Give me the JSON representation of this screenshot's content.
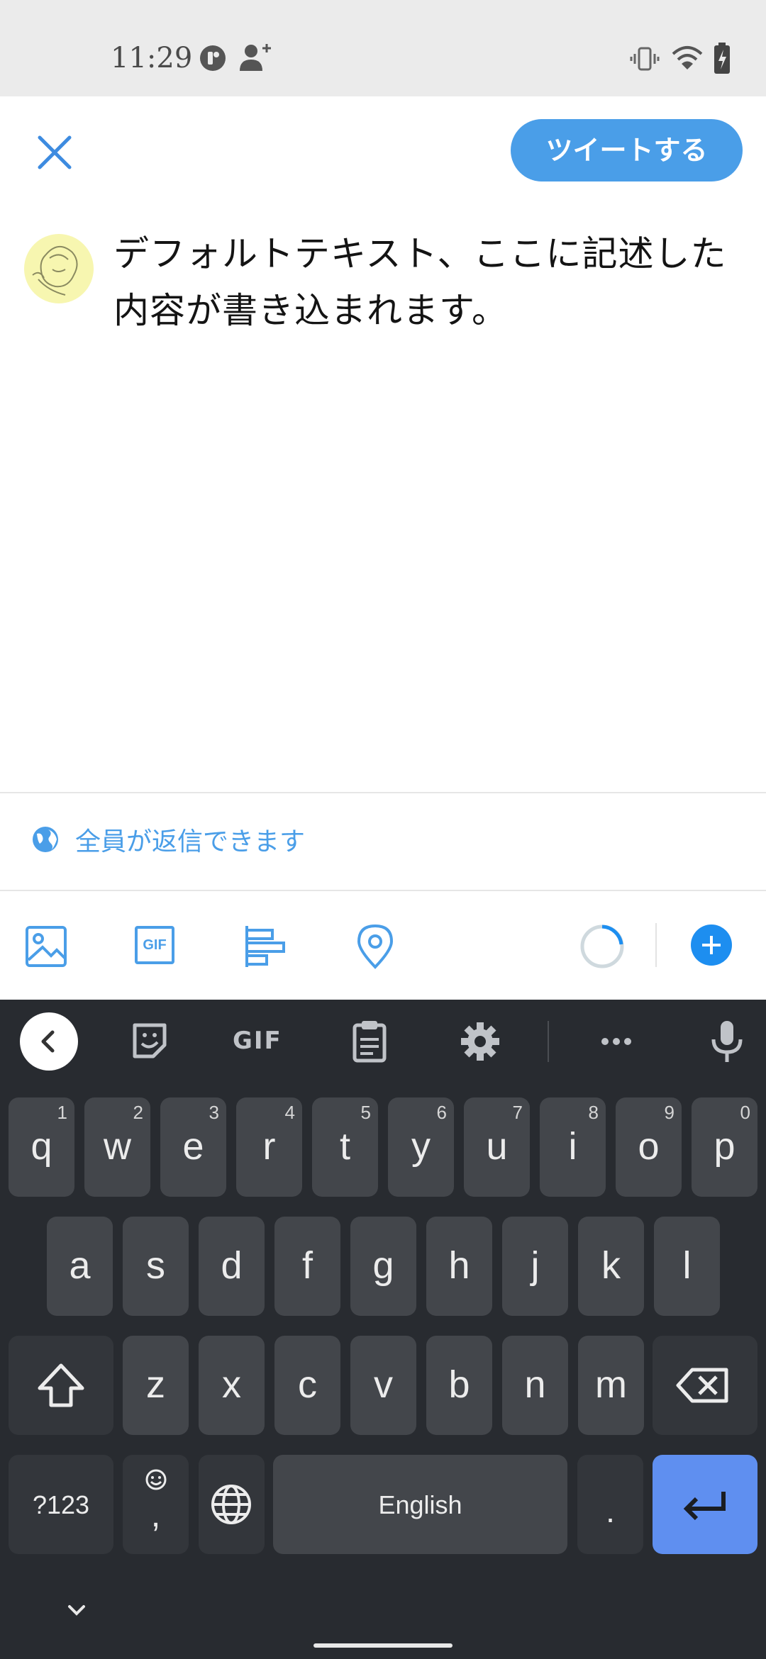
{
  "status_bar": {
    "time": "11:29",
    "icons": [
      "app-icon",
      "person-add-icon",
      "vibrate-icon",
      "wifi-icon",
      "battery-icon"
    ]
  },
  "compose": {
    "close_icon": "close-icon",
    "tweet_button_label": "ツイートする",
    "text": "デフォルトテキスト、ここに記述した内容が書き込まれます。"
  },
  "reply_setting": {
    "icon": "globe-icon",
    "label": "全員が返信できます"
  },
  "toolbar": {
    "icons": [
      "image-icon",
      "gif-icon",
      "poll-icon",
      "location-icon",
      "character-counter-icon",
      "add-icon"
    ],
    "gif_badge": "GIF"
  },
  "keyboard": {
    "toolbar": {
      "gif_label": "GIF",
      "icons": [
        "back-icon",
        "sticker-icon",
        "clipboard-icon",
        "settings-icon",
        "more-icon",
        "mic-icon"
      ]
    },
    "row1": [
      {
        "key": "q",
        "hint": "1"
      },
      {
        "key": "w",
        "hint": "2"
      },
      {
        "key": "e",
        "hint": "3"
      },
      {
        "key": "r",
        "hint": "4"
      },
      {
        "key": "t",
        "hint": "5"
      },
      {
        "key": "y",
        "hint": "6"
      },
      {
        "key": "u",
        "hint": "7"
      },
      {
        "key": "i",
        "hint": "8"
      },
      {
        "key": "o",
        "hint": "9"
      },
      {
        "key": "p",
        "hint": "0"
      }
    ],
    "row2": [
      "a",
      "s",
      "d",
      "f",
      "g",
      "h",
      "j",
      "k",
      "l"
    ],
    "row3": [
      "z",
      "x",
      "c",
      "v",
      "b",
      "n",
      "m"
    ],
    "symbols_label": "?123",
    "comma_label": ",",
    "space_label": "English",
    "period_label": ".",
    "accent_color": "#5f8ff0",
    "brand_color": "#4a9ee8"
  }
}
